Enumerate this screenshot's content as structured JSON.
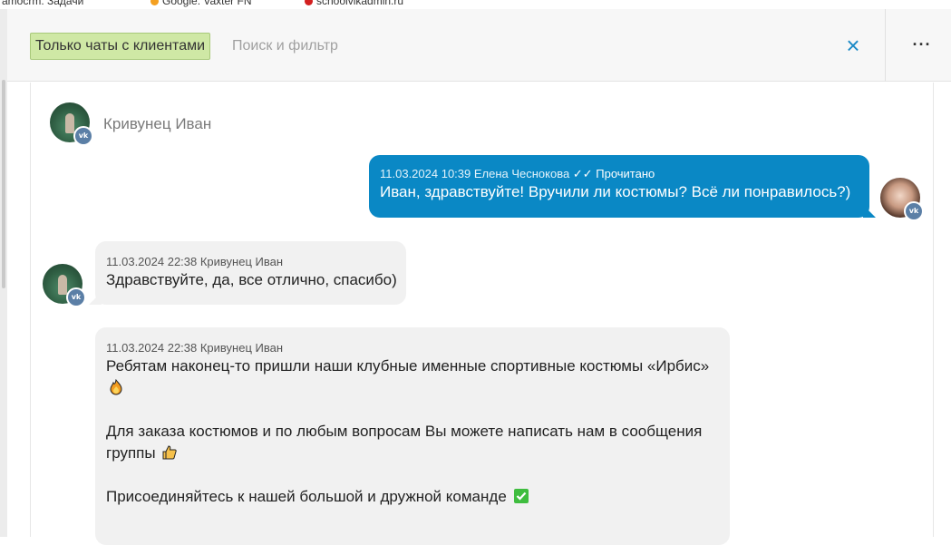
{
  "bookmarks": [
    {
      "label": "amocrm: Задачи"
    },
    {
      "label": "Google: Vaxter FN"
    },
    {
      "label": "schoolvikadmin.ru"
    }
  ],
  "header": {
    "filter_chip": "Только чаты с клиентами",
    "search_placeholder": "Поиск и фильтр",
    "close_icon": "×",
    "more_icon": "···"
  },
  "chat": {
    "contact_name": "Кривунец Иван",
    "messages": [
      {
        "direction": "outgoing",
        "meta": "11.03.2024 10:39 Елена Чеснокова",
        "status": "✓✓ Прочитано",
        "text": "Иван, здравствуйте! Вручили ли костюмы? Всё ли понравилось?)"
      },
      {
        "direction": "incoming",
        "meta": "11.03.2024 22:38 Кривунец Иван",
        "text": "Здравствуйте, да, все отлично, спасибо)"
      },
      {
        "direction": "incoming",
        "meta": "11.03.2024 22:38 Кривунец Иван",
        "paragraphs": [
          "Ребятам наконец-то пришли наши клубные именные спортивные костюмы «Ирбис»",
          "Для заказа костюмов и по любым вопросам Вы можете написать нам в сообщения группы",
          "Присоединяйтесь к нашей большой и дружной команде"
        ],
        "emojis": [
          "fire-emoji",
          "thumbs-up-emoji",
          "check-mark-emoji"
        ]
      }
    ],
    "badge_label": "vk"
  },
  "colors": {
    "accent": "#0a88c5",
    "chip_bg": "#cfe8a5",
    "incoming_bg": "#f1f1f1"
  }
}
